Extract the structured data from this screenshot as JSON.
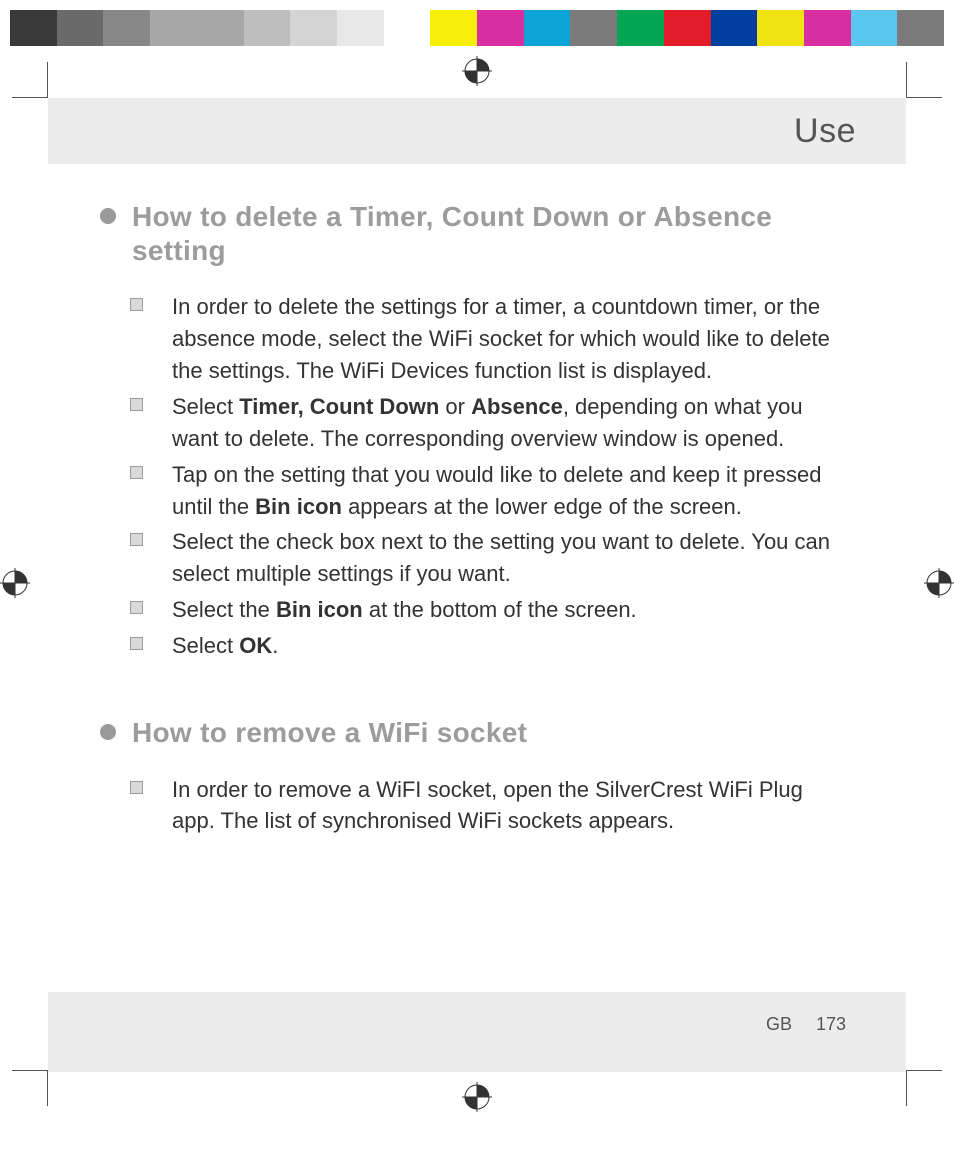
{
  "colorbar": [
    "#3a3a3a",
    "#6a6a6a",
    "#888888",
    "#a7a7a7",
    "#a7a7a7",
    "#bdbdbd",
    "#d4d4d4",
    "#e8e8e8",
    "#ffffff",
    "#f7ef0a",
    "#d92ea1",
    "#0ea3d6",
    "#7a7a7a",
    "#00a651",
    "#e21d2a",
    "#003ea0",
    "#efe313",
    "#d92ea1",
    "#5bc6ee",
    "#7a7a7a"
  ],
  "header": {
    "title": "Use"
  },
  "sections": [
    {
      "title": "How to delete a Timer, Count Down or Absence setting",
      "steps": [
        "In order to delete the settings for a timer, a countdown timer, or the absence mode, select the WiFi socket for which would like to delete the settings. The WiFi Devices function list is displayed.",
        "Select <b>Timer, Count Down</b> or <b>Absence</b>, depending on what you want to delete. The corresponding overview window is opened.",
        "Tap on the setting that you would like to delete and keep it pressed until the <b>Bin icon</b> appears at the lower edge of the screen.",
        "Select the check box next to the setting you want to delete. You can select multiple settings if you want.",
        "Select the <b>Bin icon</b> at the bottom of the screen.",
        "Select <b>OK</b>."
      ]
    },
    {
      "title": "How to remove a WiFi socket",
      "steps": [
        "In order to remove a WiFI socket, open the SilverCrest WiFi Plug app. The list of synchronised WiFi sockets appears."
      ]
    }
  ],
  "footer": {
    "lang": "GB",
    "page": "173"
  }
}
